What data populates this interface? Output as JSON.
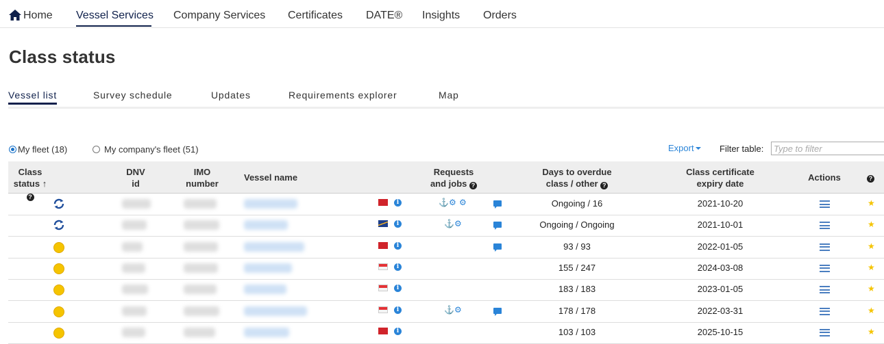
{
  "topnav": {
    "items": [
      "Home",
      "Vessel Services",
      "Company Services",
      "Certificates",
      "DATE®",
      "Insights",
      "Orders"
    ],
    "active": "Vessel Services"
  },
  "page_title": "Class status",
  "subtabs": [
    "Vessel list",
    "Survey schedule",
    "Updates",
    "Requirements explorer",
    "Map"
  ],
  "fleet": {
    "my_fleet": "My fleet (18)",
    "company_fleet": "My company's fleet (51)",
    "selected": "my_fleet"
  },
  "toolbar": {
    "export_label": "Export",
    "filter_label": "Filter table:",
    "filter_placeholder": "Type to filter"
  },
  "table": {
    "headers": {
      "class_status": [
        "Class",
        "status"
      ],
      "dnv_id": [
        "DNV",
        "id"
      ],
      "imo": [
        "IMO",
        "number"
      ],
      "vessel_name": "Vessel name",
      "requests": [
        "Requests",
        "and jobs"
      ],
      "days": [
        "Days to overdue",
        "class / other"
      ],
      "expiry": [
        "Class certificate",
        "expiry date"
      ],
      "actions": "Actions"
    },
    "rows": [
      {
        "status": "sync",
        "flag": "red",
        "requests": [
          "anchor",
          "gear",
          "gear"
        ],
        "comment": true,
        "days": "Ongoing / 16",
        "expiry": "2021-10-20"
      },
      {
        "status": "sync",
        "flag": "marshall",
        "requests": [
          "anchor",
          "gear"
        ],
        "comment": true,
        "days": "Ongoing / Ongoing",
        "expiry": "2021-10-01"
      },
      {
        "status": "yellow",
        "flag": "red",
        "requests": [],
        "comment": true,
        "days": "93 / 93",
        "expiry": "2022-01-05"
      },
      {
        "status": "yellow",
        "flag": "sg",
        "requests": [],
        "comment": false,
        "days": "155 / 247",
        "expiry": "2024-03-08"
      },
      {
        "status": "yellow",
        "flag": "sg",
        "requests": [],
        "comment": false,
        "days": "183 / 183",
        "expiry": "2023-01-05"
      },
      {
        "status": "yellow",
        "flag": "sg",
        "requests": [
          "anchor",
          "gear"
        ],
        "comment": true,
        "days": "178 / 178",
        "expiry": "2022-03-31"
      },
      {
        "status": "yellow",
        "flag": "red",
        "requests": [],
        "comment": false,
        "days": "103 / 103",
        "expiry": "2025-10-15"
      }
    ]
  },
  "colors": {
    "brand": "#0f204b",
    "link": "#2a84d8",
    "status_yellow": "#f5c400",
    "header_bg": "#eeeeee"
  }
}
